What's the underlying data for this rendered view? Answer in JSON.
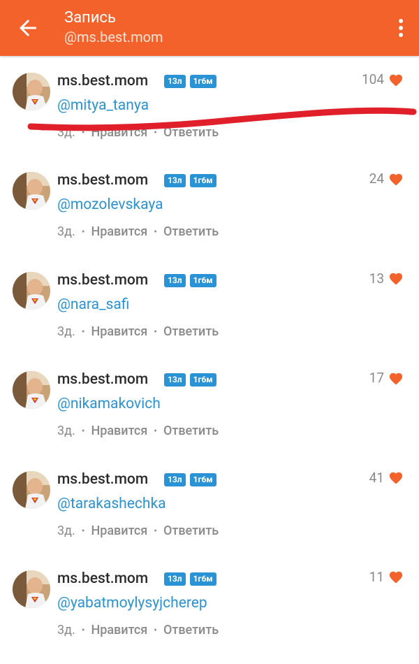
{
  "appbar": {
    "title": "Запись",
    "subtitle": "@ms.best.mom"
  },
  "comments": [
    {
      "username": "ms.best.mom",
      "badges": [
        "13л",
        "1г6м"
      ],
      "mention": "@mitya_tanya",
      "time": "3д.",
      "like_action": "Нравится",
      "reply_action": "Ответить",
      "likes": "104"
    },
    {
      "username": "ms.best.mom",
      "badges": [
        "13л",
        "1г6м"
      ],
      "mention": "@mozolevskaya",
      "time": "3д.",
      "like_action": "Нравится",
      "reply_action": "Ответить",
      "likes": "24"
    },
    {
      "username": "ms.best.mom",
      "badges": [
        "13л",
        "1г6м"
      ],
      "mention": "@nara_safi",
      "time": "3д.",
      "like_action": "Нравится",
      "reply_action": "Ответить",
      "likes": "13"
    },
    {
      "username": "ms.best.mom",
      "badges": [
        "13л",
        "1г6м"
      ],
      "mention": "@nikamakovich",
      "time": "3д.",
      "like_action": "Нравится",
      "reply_action": "Ответить",
      "likes": "17"
    },
    {
      "username": "ms.best.mom",
      "badges": [
        "13л",
        "1г6м"
      ],
      "mention": "@tarakashechka",
      "time": "3д.",
      "like_action": "Нравится",
      "reply_action": "Ответить",
      "likes": "41"
    },
    {
      "username": "ms.best.mom",
      "badges": [
        "13л",
        "1г6м"
      ],
      "mention": "@yabatmoylysyjcherep",
      "time": "3д.",
      "like_action": "Нравится",
      "reply_action": "Ответить",
      "likes": "11"
    }
  ],
  "colors": {
    "brand": "#f4622b",
    "link": "#2a93d5",
    "badge": "#2a93d5",
    "heart": "#f4622b",
    "scribble": "#e0202a"
  },
  "icons": {
    "back": "arrow-left-icon",
    "more": "more-vertical-icon",
    "like": "heart-icon"
  }
}
